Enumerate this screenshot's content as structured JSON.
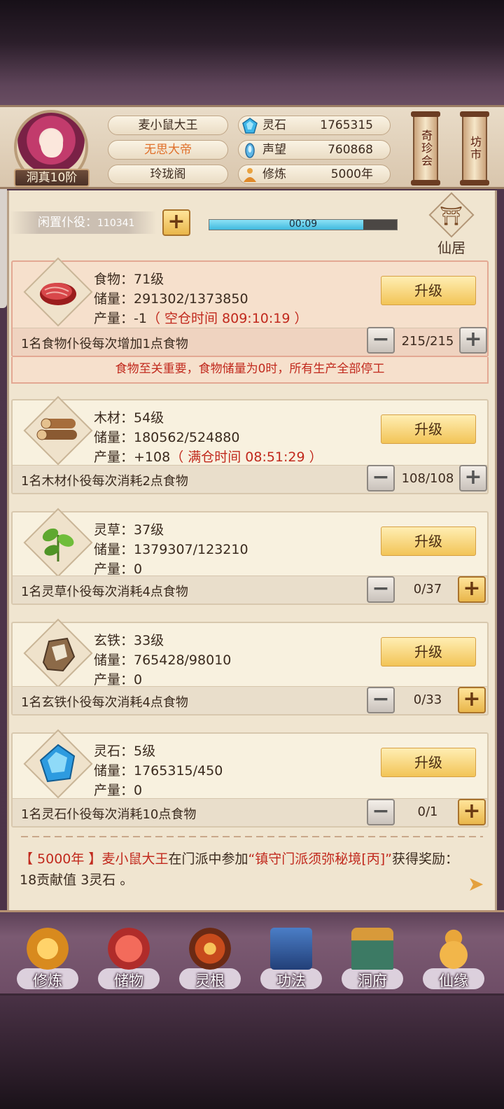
{
  "player": {
    "name": "麦小鼠大王",
    "title": "无思大帝",
    "sect": "玲珑阁",
    "rank": "洞真10阶"
  },
  "resources": [
    {
      "label": "灵石",
      "value": "1765315",
      "icon": "spirit-stone-icon"
    },
    {
      "label": "声望",
      "value": "760868",
      "icon": "prestige-icon"
    },
    {
      "label": "修炼",
      "value": "5000年",
      "icon": "cultivation-icon"
    }
  ],
  "side_buttons": {
    "qizhen": "奇珍会",
    "fangshi": "坊市"
  },
  "idle": {
    "label": "闲置仆役：",
    "count": "110341",
    "timer": "00:09",
    "timer_progress": 0.82
  },
  "xianju": {
    "label": "仙居"
  },
  "upgrade_label": "升级",
  "cards": [
    {
      "name": "食物：71级",
      "storage": "储量：291302/1373850",
      "output": "产量：-1",
      "note": "（ 空仓时间 809:10:19 ）",
      "rule": "1名食物仆役每次增加1点食物",
      "count": "215/215",
      "icon": "meat-icon"
    },
    {
      "name": "木材：54级",
      "storage": "储量：180562/524880",
      "output": "产量：+108",
      "note": "（ 满仓时间 08:51:29 ）",
      "rule": "1名木材仆役每次消耗2点食物",
      "count": "108/108",
      "icon": "wood-icon"
    },
    {
      "name": "灵草：37级",
      "storage": "储量：1379307/123210",
      "output": "产量：0",
      "note": "",
      "rule": "1名灵草仆役每次消耗4点食物",
      "count": "0/37",
      "icon": "herb-icon"
    },
    {
      "name": "玄铁：33级",
      "storage": "储量：765428/98010",
      "output": "产量：0",
      "note": "",
      "rule": "1名玄铁仆役每次消耗4点食物",
      "count": "0/33",
      "icon": "iron-ore-icon"
    },
    {
      "name": "灵石：5级",
      "storage": "储量：1765315/450",
      "output": "产量：0",
      "note": "",
      "rule": "1名灵石仆役每次消耗10点食物",
      "count": "0/1",
      "icon": "spirit-crystal-icon"
    }
  ],
  "warning": "食物至关重要，食物储量为0时，所有生产全部停工",
  "log": {
    "year": "【 5000年 】",
    "name": "麦小鼠大王",
    "mid": "在门派中参加",
    "event": "“镇守门派须弥秘境[丙]”",
    "rest": "获得奖励：18贡献值 3灵石 。"
  },
  "nav": [
    {
      "label": "修炼",
      "icon": "meditation-icon"
    },
    {
      "label": "储物",
      "icon": "storage-bag-icon"
    },
    {
      "label": "灵根",
      "icon": "spirit-root-icon"
    },
    {
      "label": "功法",
      "icon": "scripture-book-icon"
    },
    {
      "label": "洞府",
      "icon": "cave-mansion-icon"
    },
    {
      "label": "仙缘",
      "icon": "gourd-icon"
    }
  ]
}
